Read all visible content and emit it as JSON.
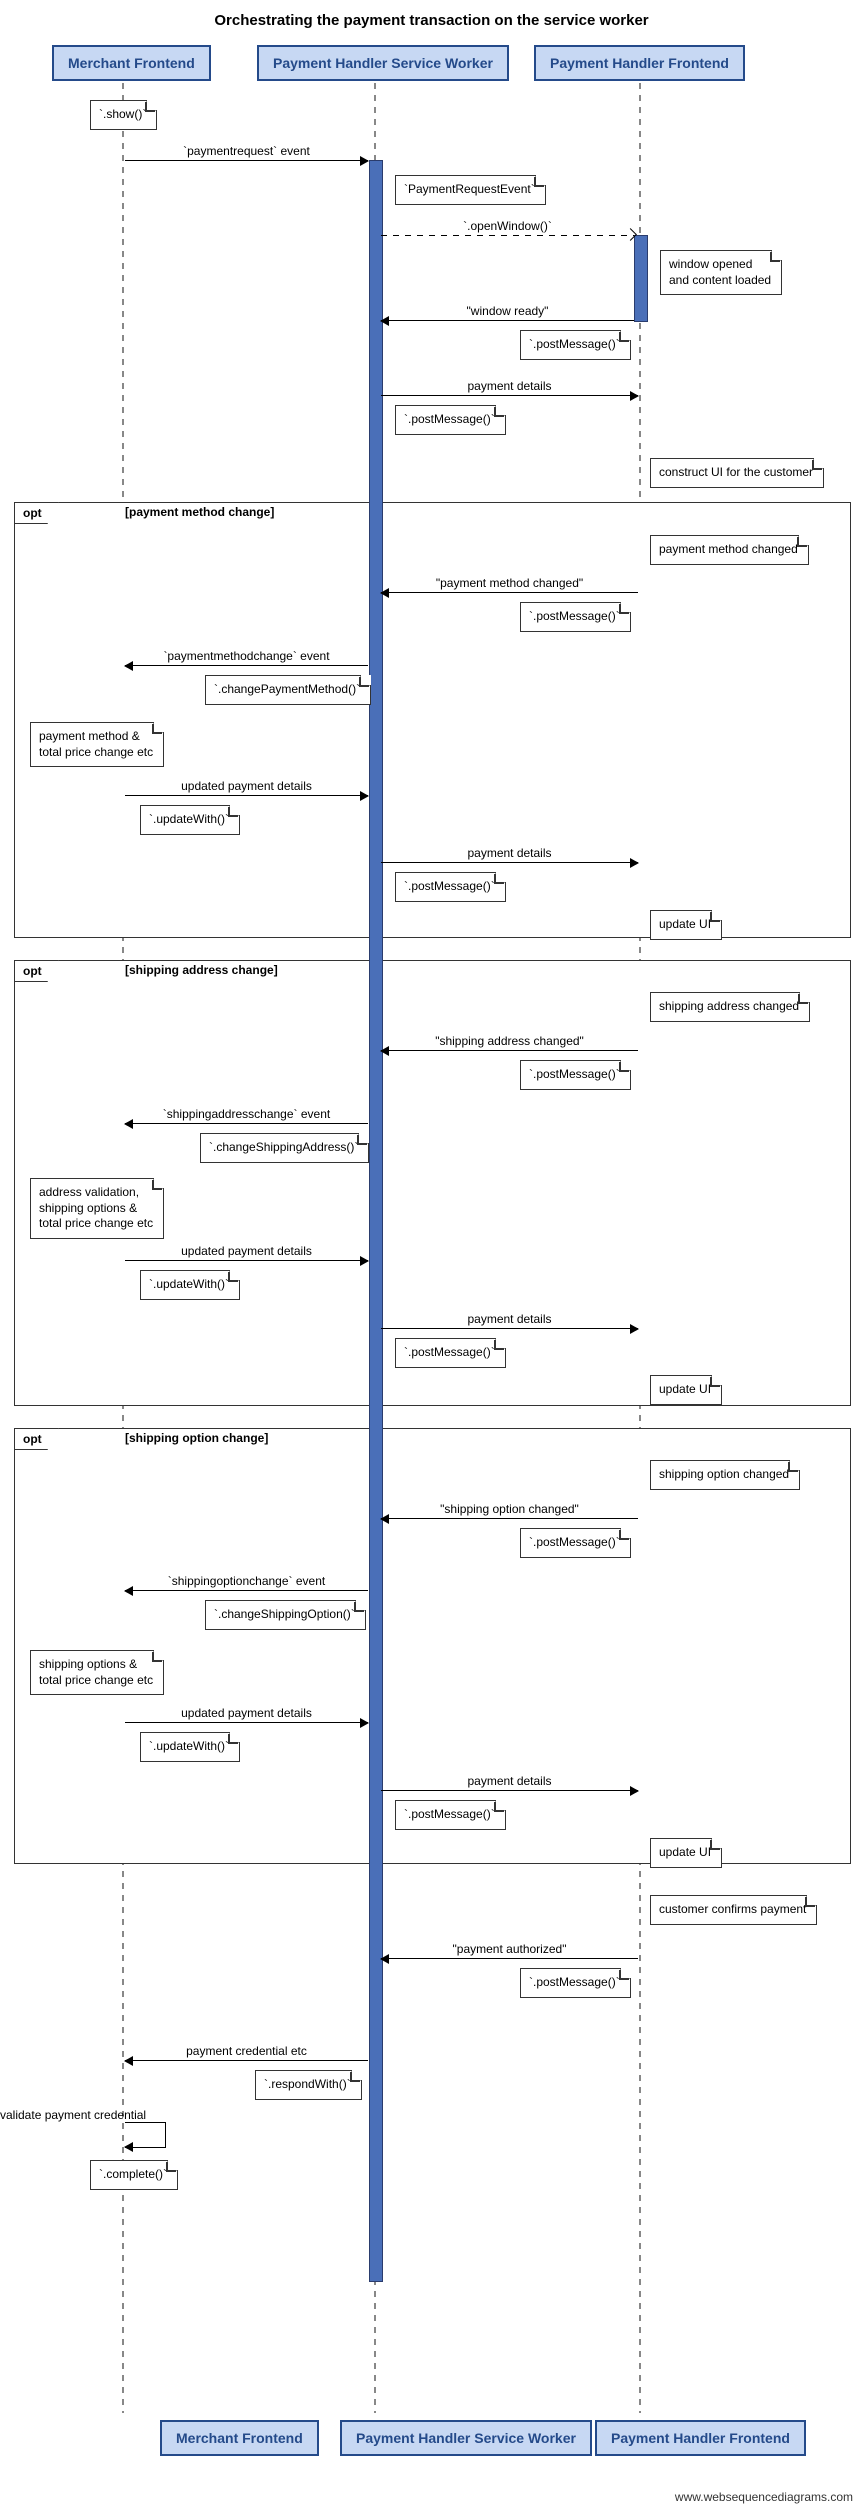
{
  "title": "Orchestrating the payment transaction on the service worker",
  "participants": {
    "merchant": "Merchant Frontend",
    "sw": "Payment Handler Service Worker",
    "frontend": "Payment Handler Frontend"
  },
  "lanes_x": {
    "merchant": 123,
    "sw": 375,
    "frontend": 640
  },
  "notes": {
    "show_call": "`.show()`",
    "pre": "`PaymentRequestEvent`",
    "window_opened": "window opened\nand content loaded",
    "post1": "`.postMessage()`",
    "post2": "`.postMessage()`",
    "construct": "construct UI for the customer",
    "pm_changed": "payment method changed",
    "post3": "`.postMessage()`",
    "change_pm": "`.changePaymentMethod()`",
    "pm_total": "payment method &\ntotal price change etc",
    "update1": "`.updateWith()`",
    "post4": "`.postMessage()`",
    "update_ui1": "update UI",
    "sa_changed": "shipping address changed",
    "post5": "`.postMessage()`",
    "change_sa": "`.changeShippingAddress()`",
    "addr_valid": "address validation,\nshipping options &\ntotal price change etc",
    "update2": "`.updateWith()`",
    "post6": "`.postMessage()`",
    "update_ui2": "update UI",
    "so_changed": "shipping option changed",
    "post7": "`.postMessage()`",
    "change_so": "`.changeShippingOption()`",
    "so_total": "shipping options &\ntotal price change etc",
    "update3": "`.updateWith()`",
    "post8": "`.postMessage()`",
    "update_ui3": "update UI",
    "confirm": "customer confirms payment",
    "post9": "`.postMessage()`",
    "respond": "`.respondWith()`",
    "validate": "validate payment credential",
    "complete": "`.complete()`"
  },
  "messages": {
    "m1": "`paymentrequest` event",
    "m2": "`.openWindow()`",
    "m3": "\"window ready\"",
    "m4": "payment details",
    "pm_msg1": "\"payment method changed\"",
    "pm_msg2": "`paymentmethodchange` event",
    "pm_msg3": "updated payment details",
    "pm_msg4": "payment details",
    "sa_msg1": "\"shipping address changed\"",
    "sa_msg2": "`shippingaddresschange` event",
    "sa_msg3": "updated payment details",
    "sa_msg4": "payment details",
    "so_msg1": "\"shipping option changed\"",
    "so_msg2": "`shippingoptionchange` event",
    "so_msg3": "updated payment details",
    "so_msg4": "payment details",
    "auth": "\"payment authorized\"",
    "cred": "payment credential etc"
  },
  "opts": {
    "opt1": "[payment method change]",
    "opt2": "[shipping address change]",
    "opt3": "[shipping option change]",
    "opt_label": "opt"
  },
  "attribution": "www.websequencediagrams.com"
}
